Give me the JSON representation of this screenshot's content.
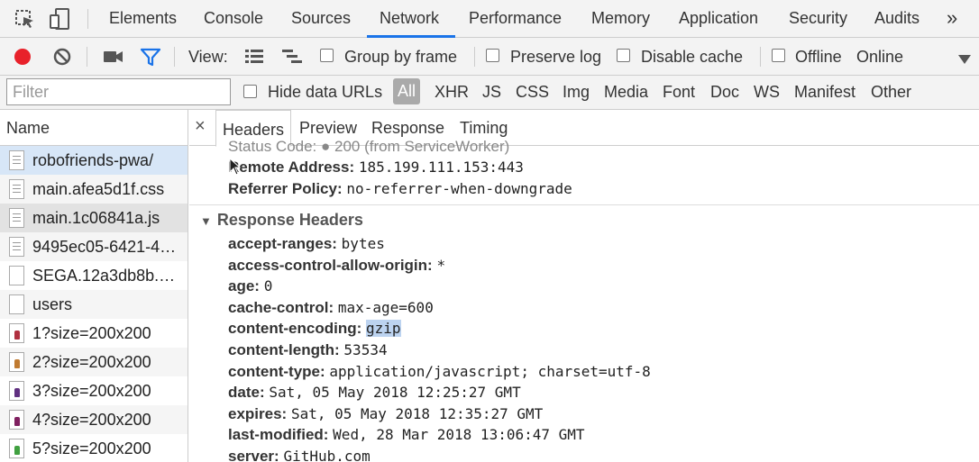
{
  "panel_tabs": [
    "Elements",
    "Console",
    "Sources",
    "Network",
    "Performance",
    "Memory",
    "Application",
    "Security",
    "Audits"
  ],
  "more_tabs_glyph": "»",
  "toolbar": {
    "view_label": "View:",
    "group_by_frame": "Group by frame",
    "preserve_log": "Preserve log",
    "disable_cache": "Disable cache",
    "offline": "Offline",
    "throttle_value": "Online",
    "record_color": "#e8212a",
    "filter_color": "#1a73e8"
  },
  "filter": {
    "placeholder": "Filter",
    "hide_data_urls": "Hide data URLs",
    "all": "All",
    "types": [
      "XHR",
      "JS",
      "CSS",
      "Img",
      "Media",
      "Font",
      "Doc",
      "WS",
      "Manifest",
      "Other"
    ]
  },
  "requests": {
    "header": "Name",
    "rows": [
      {
        "name": "robofriends-pwa/",
        "icon": "document-icon",
        "state": "selected"
      },
      {
        "name": "main.afea5d1f.css",
        "icon": "document-icon",
        "state": ""
      },
      {
        "name": "main.1c06841a.js",
        "icon": "document-icon",
        "state": "hover"
      },
      {
        "name": "9495ec05-6421-4…",
        "icon": "document-icon",
        "state": ""
      },
      {
        "name": "SEGA.12a3db8b.…",
        "icon": "blank-file-icon",
        "state": ""
      },
      {
        "name": "users",
        "icon": "blank-file-icon",
        "state": ""
      },
      {
        "name": "1?size=200x200",
        "icon": "robot-image-icon",
        "state": "",
        "color": "#b03040"
      },
      {
        "name": "2?size=200x200",
        "icon": "robot-image-icon",
        "state": "",
        "color": "#c07a30"
      },
      {
        "name": "3?size=200x200",
        "icon": "robot-image-icon",
        "state": "",
        "color": "#603080"
      },
      {
        "name": "4?size=200x200",
        "icon": "robot-image-icon",
        "state": "",
        "color": "#802060"
      },
      {
        "name": "5?size=200x200",
        "icon": "robot-image-icon",
        "state": "",
        "color": "#40a040"
      }
    ]
  },
  "detail_tabs": {
    "close": "×",
    "headers": "Headers",
    "preview": "Preview",
    "response": "Response",
    "timing": "Timing"
  },
  "general": {
    "status_partial": "Status Code: ● 200  (from ServiceWorker)",
    "remote_address": {
      "key": "Remote Address:",
      "value": "185.199.111.153:443"
    },
    "referrer_policy": {
      "key": "Referrer Policy:",
      "value": "no-referrer-when-downgrade"
    }
  },
  "response_headers": {
    "title": "Response Headers",
    "items": [
      {
        "key": "accept-ranges:",
        "value": "bytes"
      },
      {
        "key": "access-control-allow-origin:",
        "value": "*"
      },
      {
        "key": "age:",
        "value": "0"
      },
      {
        "key": "cache-control:",
        "value": "max-age=600"
      },
      {
        "key": "content-encoding:",
        "value": "gzip"
      },
      {
        "key": "content-length:",
        "value": "53534"
      },
      {
        "key": "content-type:",
        "value": "application/javascript; charset=utf-8"
      },
      {
        "key": "date:",
        "value": "Sat, 05 May 2018 12:25:27 GMT"
      },
      {
        "key": "expires:",
        "value": "Sat, 05 May 2018 12:35:27 GMT"
      },
      {
        "key": "last-modified:",
        "value": "Wed, 28 Mar 2018 13:06:47 GMT"
      },
      {
        "key": "server:",
        "value": "GitHub.com"
      }
    ]
  }
}
